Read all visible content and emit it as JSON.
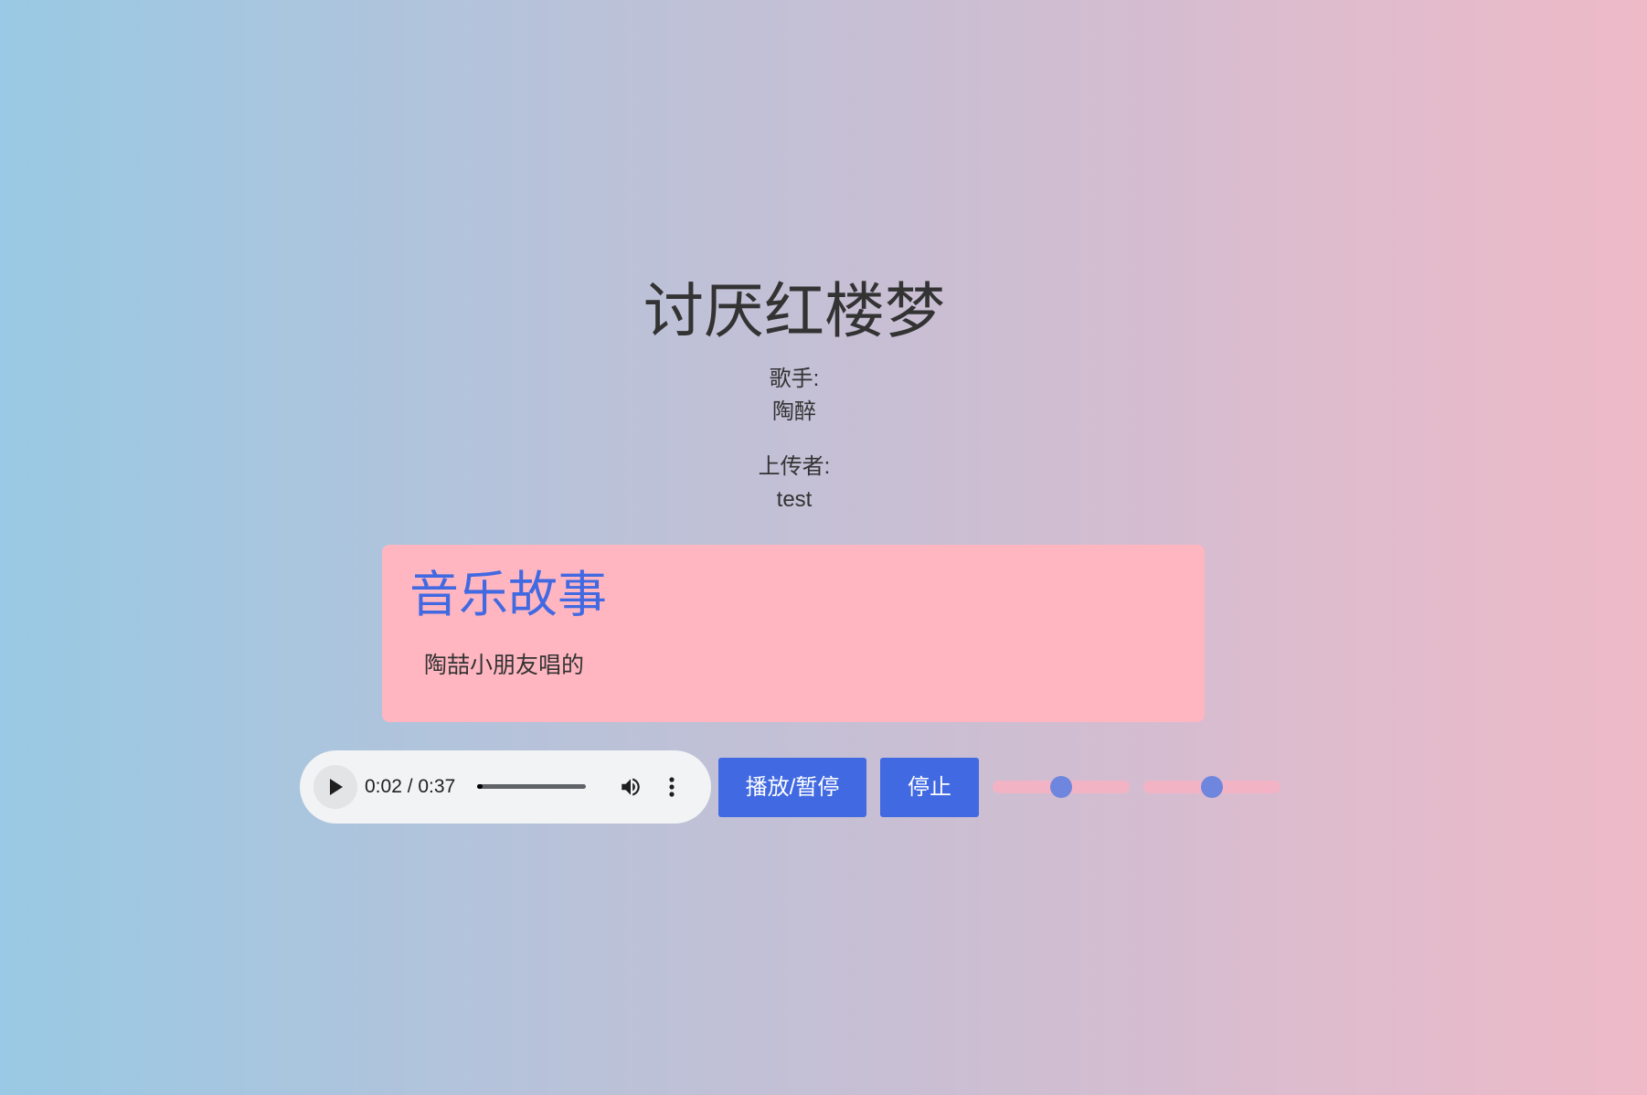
{
  "song": {
    "title": "讨厌红楼梦",
    "singer_label": "歌手:",
    "singer": "陶醉",
    "uploader_label": "上传者:",
    "uploader": "test"
  },
  "story": {
    "heading": "音乐故事",
    "text": "陶喆小朋友唱的"
  },
  "audio": {
    "time_display": "0:02 / 0:37",
    "progress_fraction": 0.054,
    "icons": [
      "play-icon",
      "volume-icon",
      "more-options-icon"
    ]
  },
  "controls": {
    "play_pause_label": "播放/暂停",
    "stop_label": "停止"
  },
  "sliders": [
    {
      "name": "slider-1",
      "value_fraction": 0.5
    },
    {
      "name": "slider-2",
      "value_fraction": 0.5
    }
  ],
  "colors": {
    "background_left": "#99c9e4",
    "background_right": "#eebac8",
    "story_box": "#ffb6c1",
    "story_heading": "#4169e1",
    "button": "#4169e1",
    "slider_track": "#f2b3c5",
    "slider_thumb": "#6f86de"
  }
}
